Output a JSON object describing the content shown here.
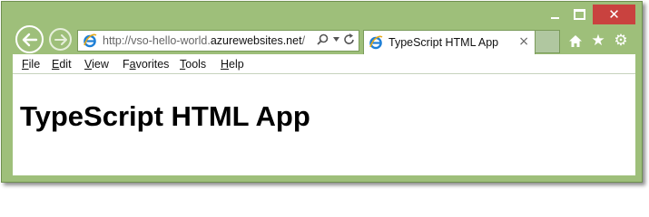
{
  "window": {
    "minimize_label": "minimize",
    "maximize_label": "maximize",
    "close_label": "✕"
  },
  "address_bar": {
    "url_prefix": "http://vso-hello-world.",
    "url_domain": "azurewebsites.net",
    "url_suffix": "/"
  },
  "tab": {
    "title": "TypeScript HTML App",
    "close_label": "×"
  },
  "toolbar": {
    "star_glyph": "★",
    "gear_glyph": "⚙"
  },
  "menu": {
    "items": [
      {
        "label": "File",
        "accel": "F"
      },
      {
        "label": "Edit",
        "accel": "E"
      },
      {
        "label": "View",
        "accel": "V"
      },
      {
        "label": "Favorites",
        "accel": "a"
      },
      {
        "label": "Tools",
        "accel": "T"
      },
      {
        "label": "Help",
        "accel": "H"
      }
    ]
  },
  "page": {
    "heading": "TypeScript HTML App"
  },
  "colors": {
    "frame": "#9ebf7a",
    "close_button": "#c9423f",
    "ie_icon": "#1e7fd6"
  },
  "icons": [
    "back-arrow-icon",
    "forward-arrow-icon",
    "ie-logo-icon",
    "search-icon",
    "dropdown-icon",
    "refresh-icon",
    "home-icon",
    "star-icon",
    "gear-icon",
    "close-icon"
  ]
}
